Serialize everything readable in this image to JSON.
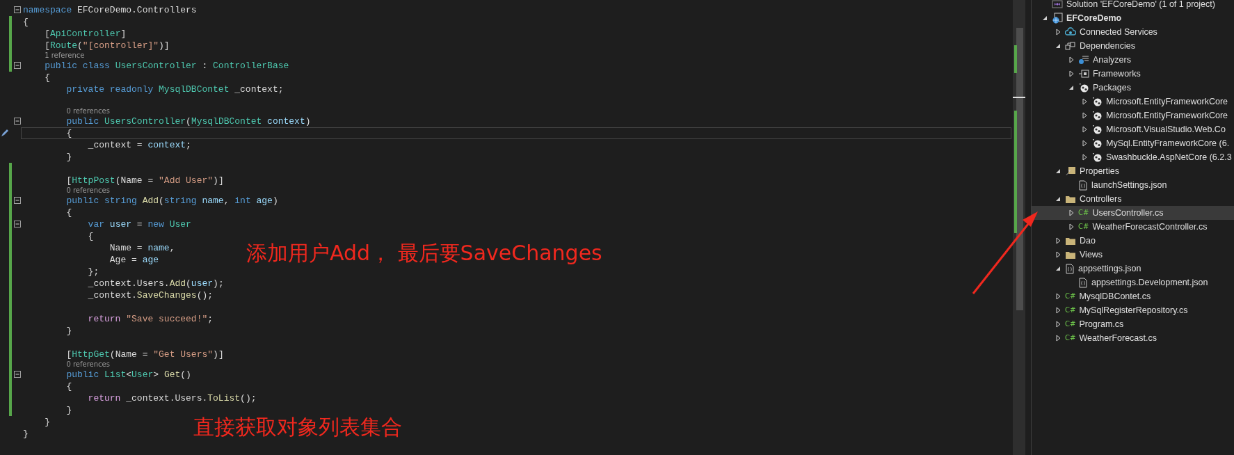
{
  "editor": {
    "lines": [
      {
        "kind": "code",
        "changed": false,
        "fold": true,
        "current": false,
        "tokens": [
          {
            "kind": "kw",
            "s": "namespace"
          },
          {
            "kind": "plain",
            "s": " EFCoreDemo.Controllers"
          }
        ]
      },
      {
        "kind": "code",
        "changed": true,
        "fold": false,
        "current": false,
        "tokens": [
          {
            "kind": "plain",
            "s": "{"
          }
        ]
      },
      {
        "kind": "code",
        "changed": true,
        "fold": false,
        "current": false,
        "tokens": [
          {
            "kind": "plain",
            "s": "    ["
          },
          {
            "kind": "type",
            "s": "ApiController"
          },
          {
            "kind": "plain",
            "s": "]"
          }
        ]
      },
      {
        "kind": "code",
        "changed": true,
        "fold": false,
        "current": false,
        "tokens": [
          {
            "kind": "plain",
            "s": "    ["
          },
          {
            "kind": "type",
            "s": "Route"
          },
          {
            "kind": "plain",
            "s": "("
          },
          {
            "kind": "str",
            "s": "\"[controller]\""
          },
          {
            "kind": "plain",
            "s": ")]"
          }
        ]
      },
      {
        "kind": "lens",
        "changed": true,
        "text": "1 reference"
      },
      {
        "kind": "code",
        "changed": true,
        "fold": true,
        "current": false,
        "tokens": [
          {
            "kind": "kw",
            "s": "    public class "
          },
          {
            "kind": "type",
            "s": "UsersController"
          },
          {
            "kind": "plain",
            "s": " : "
          },
          {
            "kind": "type",
            "s": "ControllerBase"
          }
        ]
      },
      {
        "kind": "code",
        "changed": false,
        "fold": false,
        "current": false,
        "tokens": [
          {
            "kind": "plain",
            "s": "    {"
          }
        ]
      },
      {
        "kind": "code",
        "changed": false,
        "fold": false,
        "current": false,
        "tokens": [
          {
            "kind": "kw",
            "s": "        private readonly "
          },
          {
            "kind": "type",
            "s": "MysqlDBContet"
          },
          {
            "kind": "plain",
            "s": " _context;"
          }
        ]
      },
      {
        "kind": "blank",
        "changed": false
      },
      {
        "kind": "lens",
        "changed": false,
        "text": "0 references"
      },
      {
        "kind": "code",
        "changed": false,
        "fold": true,
        "current": false,
        "tokens": [
          {
            "kind": "kw",
            "s": "        public "
          },
          {
            "kind": "type",
            "s": "UsersController"
          },
          {
            "kind": "plain",
            "s": "("
          },
          {
            "kind": "type",
            "s": "MysqlDBContet"
          },
          {
            "kind": "param",
            "s": " context"
          },
          {
            "kind": "plain",
            "s": ")"
          }
        ]
      },
      {
        "kind": "code",
        "changed": false,
        "fold": false,
        "current": true,
        "tokens": [
          {
            "kind": "plain",
            "s": "        {"
          }
        ]
      },
      {
        "kind": "code",
        "changed": false,
        "fold": false,
        "current": false,
        "tokens": [
          {
            "kind": "plain",
            "s": "            _context = "
          },
          {
            "kind": "param",
            "s": "context"
          },
          {
            "kind": "plain",
            "s": ";"
          }
        ]
      },
      {
        "kind": "code",
        "changed": false,
        "fold": false,
        "current": false,
        "tokens": [
          {
            "kind": "plain",
            "s": "        }"
          }
        ]
      },
      {
        "kind": "blank",
        "changed": true
      },
      {
        "kind": "code",
        "changed": true,
        "fold": false,
        "current": false,
        "tokens": [
          {
            "kind": "plain",
            "s": "        ["
          },
          {
            "kind": "type",
            "s": "HttpPost"
          },
          {
            "kind": "plain",
            "s": "(Name = "
          },
          {
            "kind": "str",
            "s": "\"Add User\""
          },
          {
            "kind": "plain",
            "s": ")]"
          }
        ]
      },
      {
        "kind": "lens",
        "changed": true,
        "text": "0 references"
      },
      {
        "kind": "code",
        "changed": true,
        "fold": true,
        "current": false,
        "tokens": [
          {
            "kind": "kw",
            "s": "        public string "
          },
          {
            "kind": "method",
            "s": "Add"
          },
          {
            "kind": "plain",
            "s": "("
          },
          {
            "kind": "kw",
            "s": "string "
          },
          {
            "kind": "param",
            "s": "name"
          },
          {
            "kind": "plain",
            "s": ", "
          },
          {
            "kind": "kw",
            "s": "int "
          },
          {
            "kind": "param",
            "s": "age"
          },
          {
            "kind": "plain",
            "s": ")"
          }
        ]
      },
      {
        "kind": "code",
        "changed": true,
        "fold": false,
        "current": false,
        "tokens": [
          {
            "kind": "plain",
            "s": "        {"
          }
        ]
      },
      {
        "kind": "code",
        "changed": true,
        "fold": true,
        "current": false,
        "tokens": [
          {
            "kind": "kw",
            "s": "            var "
          },
          {
            "kind": "param",
            "s": "user"
          },
          {
            "kind": "plain",
            "s": " = "
          },
          {
            "kind": "kw",
            "s": "new "
          },
          {
            "kind": "type",
            "s": "User"
          }
        ]
      },
      {
        "kind": "code",
        "changed": true,
        "fold": false,
        "current": false,
        "tokens": [
          {
            "kind": "plain",
            "s": "            {"
          }
        ]
      },
      {
        "kind": "code",
        "changed": true,
        "fold": false,
        "current": false,
        "tokens": [
          {
            "kind": "plain",
            "s": "                Name = "
          },
          {
            "kind": "param",
            "s": "name"
          },
          {
            "kind": "plain",
            "s": ","
          }
        ]
      },
      {
        "kind": "code",
        "changed": true,
        "fold": false,
        "current": false,
        "tokens": [
          {
            "kind": "plain",
            "s": "                Age = "
          },
          {
            "kind": "param",
            "s": "age"
          }
        ]
      },
      {
        "kind": "code",
        "changed": true,
        "fold": false,
        "current": false,
        "tokens": [
          {
            "kind": "plain",
            "s": "            };"
          }
        ]
      },
      {
        "kind": "code",
        "changed": true,
        "fold": false,
        "current": false,
        "tokens": [
          {
            "kind": "plain",
            "s": "            _context.Users."
          },
          {
            "kind": "method",
            "s": "Add"
          },
          {
            "kind": "plain",
            "s": "("
          },
          {
            "kind": "param",
            "s": "user"
          },
          {
            "kind": "plain",
            "s": ");"
          }
        ]
      },
      {
        "kind": "code",
        "changed": true,
        "fold": false,
        "current": false,
        "tokens": [
          {
            "kind": "plain",
            "s": "            _context."
          },
          {
            "kind": "method",
            "s": "SaveChanges"
          },
          {
            "kind": "plain",
            "s": "();"
          }
        ]
      },
      {
        "kind": "blank",
        "changed": true
      },
      {
        "kind": "code",
        "changed": true,
        "fold": false,
        "current": false,
        "tokens": [
          {
            "kind": "ctl",
            "s": "            return "
          },
          {
            "kind": "str",
            "s": "\"Save succeed!\""
          },
          {
            "kind": "plain",
            "s": ";"
          }
        ]
      },
      {
        "kind": "code",
        "changed": true,
        "fold": false,
        "current": false,
        "tokens": [
          {
            "kind": "plain",
            "s": "        }"
          }
        ]
      },
      {
        "kind": "blank",
        "changed": true
      },
      {
        "kind": "code",
        "changed": true,
        "fold": false,
        "current": false,
        "tokens": [
          {
            "kind": "plain",
            "s": "        ["
          },
          {
            "kind": "type",
            "s": "HttpGet"
          },
          {
            "kind": "plain",
            "s": "(Name = "
          },
          {
            "kind": "str",
            "s": "\"Get Users\""
          },
          {
            "kind": "plain",
            "s": ")]"
          }
        ]
      },
      {
        "kind": "lens",
        "changed": true,
        "text": "0 references"
      },
      {
        "kind": "code",
        "changed": true,
        "fold": true,
        "current": false,
        "tokens": [
          {
            "kind": "kw",
            "s": "        public "
          },
          {
            "kind": "type",
            "s": "List"
          },
          {
            "kind": "plain",
            "s": "<"
          },
          {
            "kind": "type",
            "s": "User"
          },
          {
            "kind": "plain",
            "s": "> "
          },
          {
            "kind": "method",
            "s": "Get"
          },
          {
            "kind": "plain",
            "s": "()"
          }
        ]
      },
      {
        "kind": "code",
        "changed": true,
        "fold": false,
        "current": false,
        "tokens": [
          {
            "kind": "plain",
            "s": "        {"
          }
        ]
      },
      {
        "kind": "code",
        "changed": true,
        "fold": false,
        "current": false,
        "tokens": [
          {
            "kind": "ctl",
            "s": "            return"
          },
          {
            "kind": "plain",
            "s": " _context.Users."
          },
          {
            "kind": "method",
            "s": "ToList"
          },
          {
            "kind": "plain",
            "s": "();"
          }
        ]
      },
      {
        "kind": "code",
        "changed": true,
        "fold": false,
        "current": false,
        "tokens": [
          {
            "kind": "plain",
            "s": "        }"
          }
        ]
      },
      {
        "kind": "code",
        "changed": false,
        "fold": false,
        "current": false,
        "tokens": [
          {
            "kind": "plain",
            "s": "    }"
          }
        ]
      },
      {
        "kind": "code",
        "changed": false,
        "fold": false,
        "current": false,
        "tokens": [
          {
            "kind": "plain",
            "s": "}"
          }
        ]
      }
    ]
  },
  "annotations": [
    {
      "text": "添加用户Add， 最后要SaveChanges"
    },
    {
      "text": "直接获取对象列表集合"
    }
  ],
  "solution_explorer": {
    "items": [
      {
        "label": "Solution 'EFCoreDemo' (1 of 1 project)",
        "kind": "solution",
        "selected": false
      },
      {
        "label": "EFCoreDemo",
        "kind": "project",
        "selected": false,
        "expanded": true,
        "children": [
          {
            "label": "Connected Services",
            "kind": "cloud",
            "selected": false,
            "expanded": false
          },
          {
            "label": "Dependencies",
            "kind": "deps",
            "selected": false,
            "expanded": true,
            "children": [
              {
                "label": "Analyzers",
                "kind": "analyzers",
                "selected": false,
                "expanded": false
              },
              {
                "label": "Frameworks",
                "kind": "frameworks",
                "selected": false,
                "expanded": false
              },
              {
                "label": "Packages",
                "kind": "package",
                "selected": false,
                "expanded": true,
                "children": [
                  {
                    "label": "Microsoft.EntityFrameworkCore",
                    "kind": "package",
                    "selected": false,
                    "expanded": false
                  },
                  {
                    "label": "Microsoft.EntityFrameworkCore",
                    "kind": "package",
                    "selected": false,
                    "expanded": false
                  },
                  {
                    "label": "Microsoft.VisualStudio.Web.Co",
                    "kind": "package",
                    "selected": false,
                    "expanded": false
                  },
                  {
                    "label": "MySql.EntityFrameworkCore (6.",
                    "kind": "package",
                    "selected": false,
                    "expanded": false
                  },
                  {
                    "label": "Swashbuckle.AspNetCore (6.2.3",
                    "kind": "package",
                    "selected": false,
                    "expanded": false
                  }
                ]
              }
            ]
          },
          {
            "label": "Properties",
            "kind": "properties",
            "selected": false,
            "expanded": true,
            "children": [
              {
                "label": "launchSettings.json",
                "kind": "json",
                "selected": false
              }
            ]
          },
          {
            "label": "Controllers",
            "kind": "folder",
            "selected": false,
            "expanded": true,
            "children": [
              {
                "label": "UsersController.cs",
                "kind": "cs",
                "icon_text": "C#",
                "selected": true,
                "expanded": false
              },
              {
                "label": "WeatherForecastController.cs",
                "kind": "cs",
                "icon_text": "C#",
                "selected": false,
                "expanded": false
              }
            ]
          },
          {
            "label": "Dao",
            "kind": "folder",
            "selected": false,
            "expanded": false
          },
          {
            "label": "Views",
            "kind": "folder",
            "selected": false,
            "expanded": false
          },
          {
            "label": "appsettings.json",
            "kind": "json",
            "selected": false,
            "expanded": true,
            "children": [
              {
                "label": "appsettings.Development.json",
                "kind": "json",
                "selected": false
              }
            ]
          },
          {
            "label": "MysqlDBContet.cs",
            "kind": "cs",
            "icon_text": "C#",
            "selected": false,
            "expanded": false
          },
          {
            "label": "MySqlRegisterRepository.cs",
            "kind": "cs",
            "icon_text": "C#",
            "selected": false,
            "expanded": false
          },
          {
            "label": "Program.cs",
            "kind": "cs",
            "icon_text": "C#",
            "selected": false,
            "expanded": false
          },
          {
            "label": "WeatherForecast.cs",
            "kind": "cs",
            "icon_text": "C#",
            "selected": false,
            "expanded": false
          }
        ]
      }
    ]
  }
}
